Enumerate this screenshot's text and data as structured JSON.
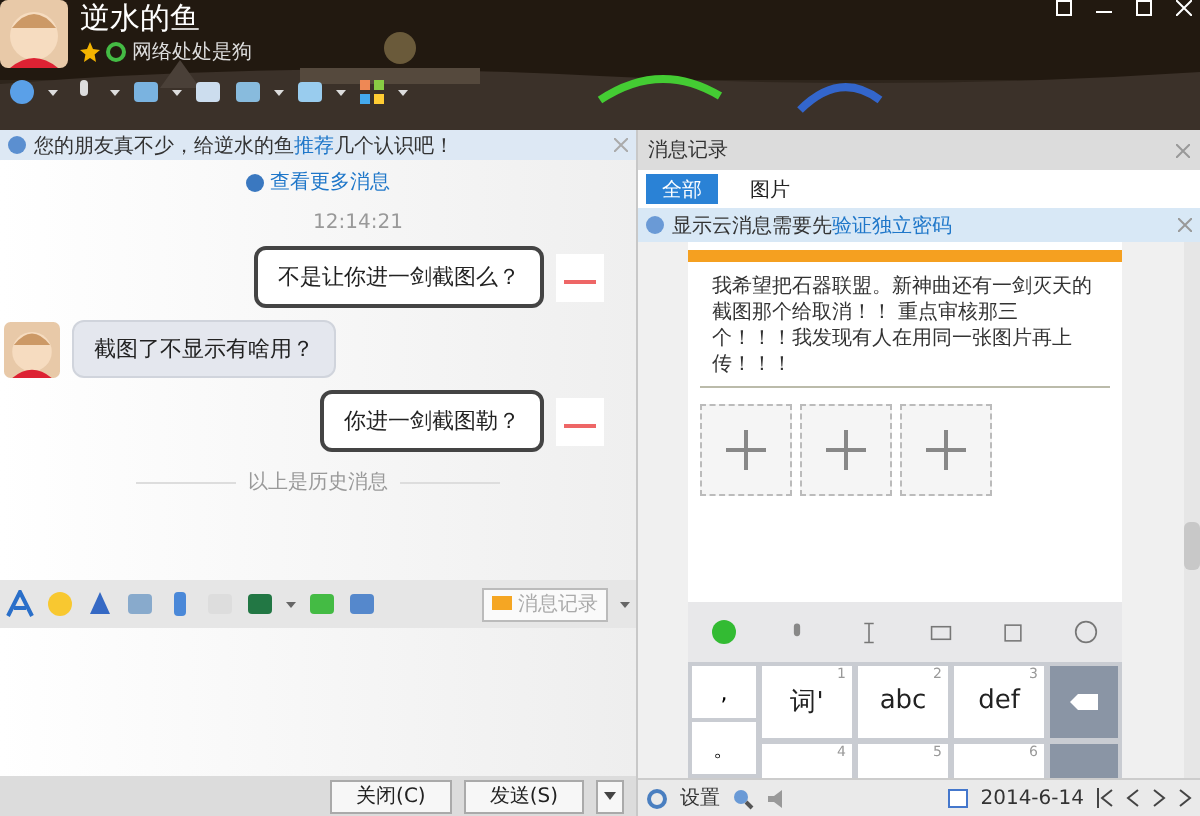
{
  "window": {
    "title": "逆水的鱼",
    "signature": "网络处处是狗"
  },
  "notice": {
    "before": "您的朋友真不少，给逆水的鱼",
    "link": "推荐",
    "after": "几个认识吧！"
  },
  "more_link": "查看更多消息",
  "messages": [
    {
      "kind": "time",
      "text": "12:14:21"
    },
    {
      "kind": "sent",
      "text": "不是让你进一剑截图么？"
    },
    {
      "kind": "received",
      "text": "截图了不显示有啥用？"
    },
    {
      "kind": "sent",
      "text": "你进一剑截图勒？"
    },
    {
      "kind": "divider",
      "text": "以上是历史消息"
    }
  ],
  "chat_toolbar": {
    "history_button": "消息记录",
    "history_disabled": true
  },
  "buttons": [
    {
      "label": "关闭(C)"
    },
    {
      "label": "发送(S)"
    }
  ],
  "history": {
    "title": "消息记录",
    "tabs": [
      {
        "label": "全部",
        "selected": true
      },
      {
        "label": "图片",
        "selected": false
      }
    ],
    "notice": {
      "before": "显示云消息需要先",
      "link": "验证独立密码"
    },
    "post": "我希望把石器联盟。新神曲还有一剑灭天的截图那个给取消！！ 重点审核那三个！！！我发现有人在用同一张图片再上传！！！",
    "keys_left": [
      ",",
      "。"
    ],
    "keys_row1": [
      {
        "label": "词'",
        "num": "1"
      },
      {
        "label": "abc",
        "num": "2"
      },
      {
        "label": "def",
        "num": "3"
      }
    ],
    "keys_row2": [
      {
        "num": "4"
      },
      {
        "num": "5"
      },
      {
        "num": "6"
      }
    ],
    "settings": "设置",
    "date": "2014-6-14"
  }
}
